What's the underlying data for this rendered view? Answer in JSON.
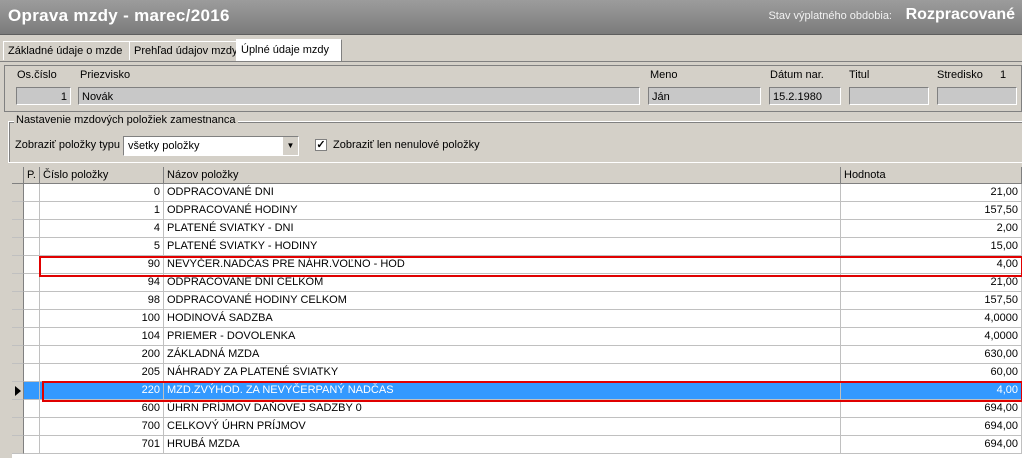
{
  "window": {
    "title": "Oprava mzdy - marec/2016",
    "status_label": "Stav výplatného obdobia:",
    "status_value": "Rozpracované"
  },
  "tabs": [
    {
      "label": "Základné údaje o mzde"
    },
    {
      "label": "Prehľad údajov mzdy"
    },
    {
      "label": "Úplné údaje mzdy"
    }
  ],
  "employee": {
    "labels": {
      "os_cislo": "Os.číslo",
      "priezvisko": "Priezvisko",
      "meno": "Meno",
      "datum_nar": "Dátum nar.",
      "titul": "Titul",
      "stredisko": "Stredisko"
    },
    "os_cislo": "1",
    "priezvisko": "Novák",
    "meno": "Ján",
    "datum_nar": "15.2.1980",
    "titul": "",
    "stredisko": "",
    "page_number": "1"
  },
  "settings": {
    "group_title": "Nastavenie mzdových položiek zamestnanca",
    "filter_label": "Zobraziť položky typu",
    "filter_value": "všetky položky",
    "checkbox_label": "Zobraziť len nenulové položky",
    "checkbox_checked": true
  },
  "grid": {
    "headers": {
      "p": "P.",
      "cislo": "Číslo položky",
      "nazov": "Názov položky",
      "hodnota": "Hodnota"
    },
    "rows": [
      {
        "cislo": "0",
        "nazov": "ODPRACOVANÉ DNI",
        "hodnota": "21,00"
      },
      {
        "cislo": "1",
        "nazov": "ODPRACOVANÉ HODINY",
        "hodnota": "157,50"
      },
      {
        "cislo": "4",
        "nazov": "PLATENÉ SVIATKY - DNI",
        "hodnota": "2,00"
      },
      {
        "cislo": "5",
        "nazov": "PLATENÉ SVIATKY - HODINY",
        "hodnota": "15,00"
      },
      {
        "cislo": "90",
        "nazov": "NEVYČER.NADČAS PRE NÁHR.VOĽNO - HOD",
        "hodnota": "4,00"
      },
      {
        "cislo": "94",
        "nazov": "ODPRACOVANÉ DNI CELKOM",
        "hodnota": "21,00"
      },
      {
        "cislo": "98",
        "nazov": "ODPRACOVANÉ HODINY CELKOM",
        "hodnota": "157,50"
      },
      {
        "cislo": "100",
        "nazov": "HODINOVÁ SADZBA",
        "hodnota": "4,0000"
      },
      {
        "cislo": "104",
        "nazov": "PRIEMER - DOVOLENKA",
        "hodnota": "4,0000"
      },
      {
        "cislo": "200",
        "nazov": "ZÁKLADNÁ MZDA",
        "hodnota": "630,00"
      },
      {
        "cislo": "205",
        "nazov": "NÁHRADY ZA PLATENÉ SVIATKY",
        "hodnota": "60,00"
      },
      {
        "cislo": "220",
        "nazov": "MZD.ZVÝHOD. ZA NEVYČERPANÝ NADČAS",
        "hodnota": "4,00"
      },
      {
        "cislo": "600",
        "nazov": "ÚHRN PRÍJMOV DAŇOVEJ SADZBY 0",
        "hodnota": "694,00"
      },
      {
        "cislo": "700",
        "nazov": "CELKOVÝ ÚHRN PRÍJMOV",
        "hodnota": "694,00"
      },
      {
        "cislo": "701",
        "nazov": "HRUBÁ MZDA",
        "hodnota": "694,00"
      }
    ]
  }
}
